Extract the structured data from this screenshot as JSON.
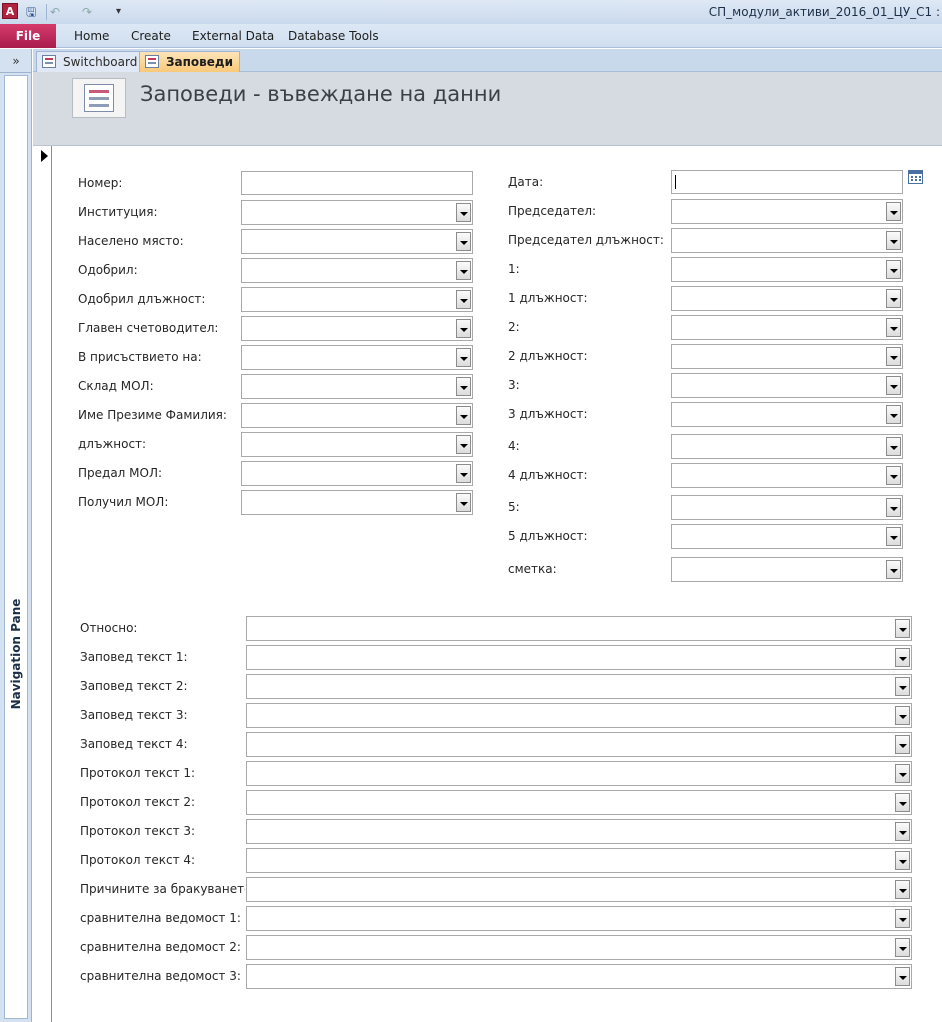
{
  "window": {
    "title": "СП_модули_активи_2016_01_ЦУ_С1 :"
  },
  "quick_access": {
    "save": "🖫",
    "undo": "↶",
    "redo": "↷",
    "more": "▾"
  },
  "ribbon": {
    "file": "File",
    "tabs": [
      "Home",
      "Create",
      "External Data",
      "Database Tools"
    ]
  },
  "nav_pane": {
    "collapse": "»",
    "label": "Navigation Pane"
  },
  "doc_tabs": [
    {
      "label": "Switchboard",
      "active": false
    },
    {
      "label": "Заповеди",
      "active": true
    }
  ],
  "form": {
    "title": "Заповеди - въвеждане на данни",
    "left_fields": [
      {
        "label": "Номер:",
        "type": "text",
        "value": ""
      },
      {
        "label": "Институция:",
        "type": "combo",
        "value": ""
      },
      {
        "label": "Населено място:",
        "type": "combo",
        "value": ""
      },
      {
        "label": "Одобрил:",
        "type": "combo",
        "value": ""
      },
      {
        "label": "Одобрил длъжност:",
        "type": "combo",
        "value": ""
      },
      {
        "label": "Главен счетоводител:",
        "type": "combo",
        "value": ""
      },
      {
        "label": "В присъствието на:",
        "type": "combo",
        "value": ""
      },
      {
        "label": "Склад МОЛ:",
        "type": "combo",
        "value": ""
      },
      {
        "label": "Име Презиме Фамилия:",
        "type": "combo",
        "value": ""
      },
      {
        "label": "длъжност:",
        "type": "combo",
        "value": ""
      },
      {
        "label": "Предал МОЛ:",
        "type": "combo",
        "value": ""
      },
      {
        "label": "Получил МОЛ:",
        "type": "combo",
        "value": ""
      }
    ],
    "right_fields": [
      {
        "label": "Дата:",
        "type": "text",
        "value": ""
      },
      {
        "label": "Председател:",
        "type": "combo",
        "value": ""
      },
      {
        "label": "Председател длъжност:",
        "type": "combo",
        "value": ""
      },
      {
        "label": "1:",
        "type": "combo",
        "value": ""
      },
      {
        "label": "1 длъжност:",
        "type": "combo",
        "value": ""
      },
      {
        "label": "2:",
        "type": "combo",
        "value": ""
      },
      {
        "label": "2 длъжност:",
        "type": "combo",
        "value": ""
      },
      {
        "label": "3:",
        "type": "combo",
        "value": ""
      },
      {
        "label": "3 длъжност:",
        "type": "combo",
        "value": ""
      },
      {
        "label": "4:",
        "type": "combo",
        "value": ""
      },
      {
        "label": "4 длъжност:",
        "type": "combo",
        "value": ""
      },
      {
        "label": "5:",
        "type": "combo",
        "value": ""
      },
      {
        "label": "5 длъжност:",
        "type": "combo",
        "value": ""
      },
      {
        "label": "сметка:",
        "type": "combo",
        "value": ""
      }
    ],
    "wide_fields": [
      {
        "label": "Относно:",
        "value": ""
      },
      {
        "label": "Заповед текст 1:",
        "value": ""
      },
      {
        "label": "Заповед текст 2:",
        "value": ""
      },
      {
        "label": "Заповед текст 3:",
        "value": ""
      },
      {
        "label": "Заповед текст 4:",
        "value": ""
      },
      {
        "label": "Протокол текст 1:",
        "value": ""
      },
      {
        "label": "Протокол текст 2:",
        "value": ""
      },
      {
        "label": "Протокол текст 3:",
        "value": ""
      },
      {
        "label": "Протокол текст 4:",
        "value": ""
      },
      {
        "label": "Причините за бракуването:",
        "value": ""
      },
      {
        "label": "сравнителна ведомост 1:",
        "value": ""
      },
      {
        "label": "сравнителна ведомост 2:",
        "value": ""
      },
      {
        "label": "сравнителна ведомост 3:",
        "value": ""
      }
    ]
  }
}
